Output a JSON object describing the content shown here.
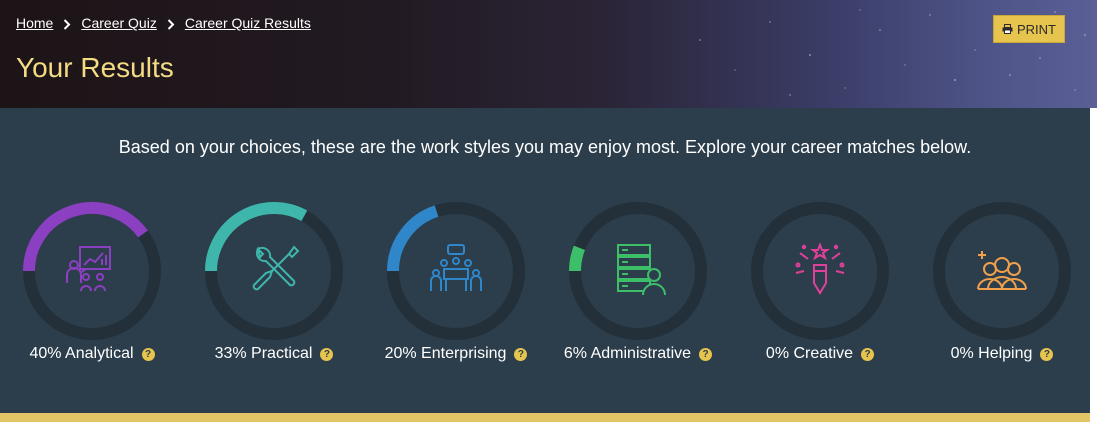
{
  "breadcrumb": [
    {
      "label": "Home"
    },
    {
      "label": "Career Quiz"
    },
    {
      "label": "Career Quiz Results"
    }
  ],
  "title": "Your Results",
  "print_label": "PRINT",
  "intro": "Based on your choices, these are the work styles you may enjoy most. Explore your career matches below.",
  "styles": [
    {
      "label": "40% Analytical",
      "percent": 40,
      "color": "#8b3fc1",
      "icon": "presentation-chart-icon"
    },
    {
      "label": "33% Practical",
      "percent": 33,
      "color": "#3fb6ac",
      "icon": "tools-icon"
    },
    {
      "label": "20% Enterprising",
      "percent": 20,
      "color": "#2f86c8",
      "icon": "meeting-icon"
    },
    {
      "label": "6% Administrative",
      "percent": 6,
      "color": "#3dbf6a",
      "icon": "server-user-icon"
    },
    {
      "label": "0% Creative",
      "percent": 0,
      "color": "#e0409a",
      "icon": "creative-pencil-icon"
    },
    {
      "label": "0% Helping",
      "percent": 0,
      "color": "#f0a04b",
      "icon": "helping-people-icon"
    }
  ],
  "colors": {
    "accent": "#e7c44d",
    "title": "#f3dc83",
    "panel": "#2c3e4c",
    "ring_track": "#233039"
  }
}
